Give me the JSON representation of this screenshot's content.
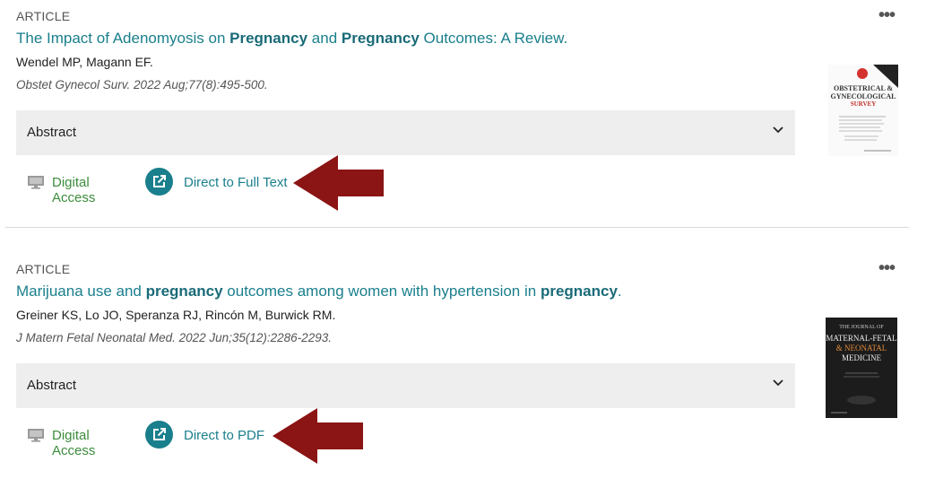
{
  "results": [
    {
      "type": "ARTICLE",
      "title_parts": [
        "The Impact of Adenomyosis on ",
        "Pregnancy",
        " and ",
        "Pregnancy",
        " Outcomes: A Review."
      ],
      "authors": "Wendel MP, Magann EF.",
      "source": "Obstet Gynecol Surv. 2022 Aug;77(8):495-500.",
      "abstract_label": "Abstract",
      "digital_access_label": "Digital Access",
      "direct_link_label": "Direct to Full Text",
      "cover": {
        "line1": "OBSTETRICAL &",
        "line2": "GYNECOLOGICAL",
        "line3": "SURVEY"
      }
    },
    {
      "type": "ARTICLE",
      "title_parts": [
        "Marijuana use and ",
        "pregnancy",
        " outcomes among women with hypertension in ",
        "pregnancy",
        "."
      ],
      "authors": "Greiner KS, Lo JO, Speranza RJ, Rincón M, Burwick RM.",
      "source": "J Matern Fetal Neonatal Med. 2022 Jun;35(12):2286-2293.",
      "abstract_label": "Abstract",
      "digital_access_label": "Digital Access",
      "direct_link_label": "Direct to PDF",
      "cover": {
        "line0": "THE JOURNAL OF",
        "line1": "MATERNAL-FETAL",
        "line2": "& NEONATAL",
        "line3": "MEDICINE"
      }
    }
  ],
  "colors": {
    "link": "#1a7f8c",
    "access_green": "#3c8c3c",
    "arrow": "#8b1414",
    "abstract_bg": "#eeeeee"
  }
}
